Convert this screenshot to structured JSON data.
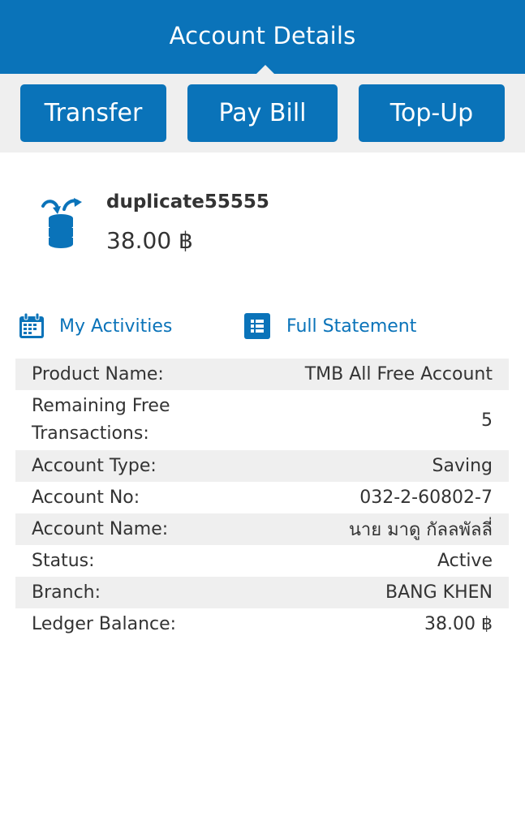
{
  "header": {
    "title": "Account Details"
  },
  "actions": {
    "transfer": "Transfer",
    "pay_bill": "Pay Bill",
    "top_up": "Top-Up"
  },
  "account": {
    "nickname": "duplicate55555",
    "balance": "38.00 ฿",
    "icon": "savings-coins-icon"
  },
  "links": {
    "activities": "My Activities",
    "statement": "Full Statement"
  },
  "details": [
    {
      "label": "Product Name:",
      "value": "TMB All Free Account"
    },
    {
      "label": "Remaining Free Transactions:",
      "value": "5"
    },
    {
      "label": "Account Type:",
      "value": "Saving"
    },
    {
      "label": "Account No:",
      "value": "032-2-60802-7"
    },
    {
      "label": "Account Name:",
      "value": "นาย มาดู กัลลพัลลี่"
    },
    {
      "label": "Status:",
      "value": "Active"
    },
    {
      "label": "Branch:",
      "value": "BANG KHEN"
    },
    {
      "label": "Ledger Balance:",
      "value": "38.00 ฿"
    }
  ],
  "colors": {
    "primary": "#0a73b9",
    "band": "#efefef",
    "text": "#333333"
  }
}
